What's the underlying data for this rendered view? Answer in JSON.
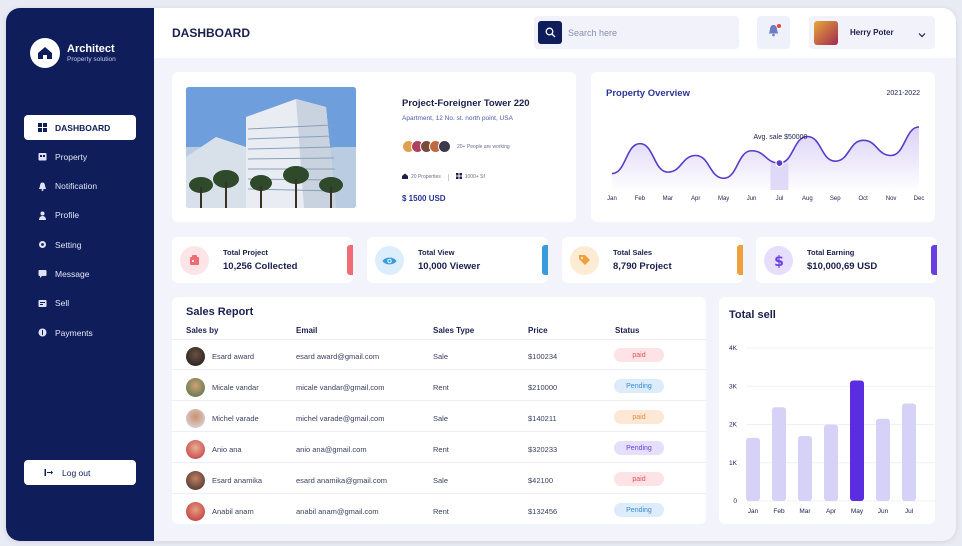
{
  "brand": {
    "name": "Architect",
    "tagline": "Property solution"
  },
  "sidebar": {
    "items": [
      {
        "label": "DASHBOARD",
        "icon": "grid-icon"
      },
      {
        "label": "Property",
        "icon": "building-icon"
      },
      {
        "label": "Notification",
        "icon": "bell-icon"
      },
      {
        "label": "Profile",
        "icon": "user-icon"
      },
      {
        "label": "Setting",
        "icon": "gear-icon"
      },
      {
        "label": "Message",
        "icon": "message-icon"
      },
      {
        "label": "Sell",
        "icon": "sell-icon"
      },
      {
        "label": "Payments",
        "icon": "dollar-icon"
      }
    ],
    "logout": "Log out"
  },
  "header": {
    "title": "DASHBOARD",
    "search_placeholder": "Search here",
    "user_name": "Herry Poter"
  },
  "property": {
    "title": "Project-Foreigner Tower 220",
    "address": "Apartment, 12 No. st. north point, USA",
    "people": "20+ People are working",
    "properties": "20 Properties",
    "area": "1000+ Sf",
    "price": "$ 1500 USD"
  },
  "overview": {
    "title": "Property Overview",
    "range": "2021-2022",
    "annotation": "Avg. sale $50000"
  },
  "stats": [
    {
      "label": "Total Project",
      "value": "10,256 Collected",
      "icon": "project-icon",
      "color": "#f06b73",
      "bg": "#fde5e7"
    },
    {
      "label": "Total View",
      "value": "10,000 Viewer",
      "icon": "eye-icon",
      "color": "#3b9ad9",
      "bg": "#dceefb"
    },
    {
      "label": "Total Sales",
      "value": "8,790 Project",
      "icon": "tag-icon",
      "color": "#f0a03a",
      "bg": "#fdecd3"
    },
    {
      "label": "Total Earning",
      "value": "$10,000,69 USD",
      "icon": "dollar-icon",
      "color": "#6a3fe0",
      "bg": "#e6defc"
    }
  ],
  "sales_report": {
    "title": "Sales Report",
    "headers": [
      "Sales by",
      "Email",
      "Sales Type",
      "Price",
      "Status"
    ],
    "rows": [
      {
        "name": "Esard award",
        "email": "esard award@gmail.com",
        "type": "Sale",
        "price": "$100234",
        "status": "paid"
      },
      {
        "name": "Micale vandar",
        "email": "micale vandar@gmail.com",
        "type": "Rent",
        "price": "$210000",
        "status": "Pending"
      },
      {
        "name": "Michel varade",
        "email": "michel varade@gmail.com",
        "type": "Sale",
        "price": "$140211",
        "status": "paid"
      },
      {
        "name": "Anio ana",
        "email": "anio ana@gmail.com",
        "type": "Rent",
        "price": "$320233",
        "status": "Pending"
      },
      {
        "name": "Esard anamika",
        "email": "esard anamika@gmail.com",
        "type": "Sale",
        "price": "$42100",
        "status": "paid"
      },
      {
        "name": "Anabil anam",
        "email": "anabil anam@gmail.com",
        "type": "Rent",
        "price": "$132456",
        "status": "Pending"
      }
    ]
  },
  "colors": {
    "navy": "#0f1e5a",
    "accent": "#5b2de0",
    "paid_bg": "#fde3e5",
    "paid_fg": "#e0505a",
    "pending_bg": "#dcecfb",
    "pending_fg": "#3a8ad0"
  },
  "chart_data": [
    {
      "type": "line",
      "title": "Property Overview",
      "x": [
        "Jan",
        "Feb",
        "Mar",
        "Apr",
        "May",
        "Jun",
        "Jul",
        "Aug",
        "Sep",
        "Oct",
        "Nov",
        "Dec"
      ],
      "values": [
        22,
        85,
        25,
        60,
        12,
        70,
        44,
        100,
        48,
        92,
        60,
        120
      ],
      "highlight_index": 6,
      "annotation": "Avg. sale $50000"
    },
    {
      "type": "bar",
      "title": "Total sell",
      "categories": [
        "Jan",
        "Feb",
        "Mar",
        "Apr",
        "May",
        "Jun",
        "Jul"
      ],
      "values": [
        1650,
        2450,
        1700,
        2000,
        3150,
        2150,
        2550
      ],
      "highlight_index": 4,
      "yticks": [
        "0",
        "1K",
        "2K",
        "3K",
        "4K"
      ],
      "ylim": [
        0,
        4000
      ]
    }
  ]
}
